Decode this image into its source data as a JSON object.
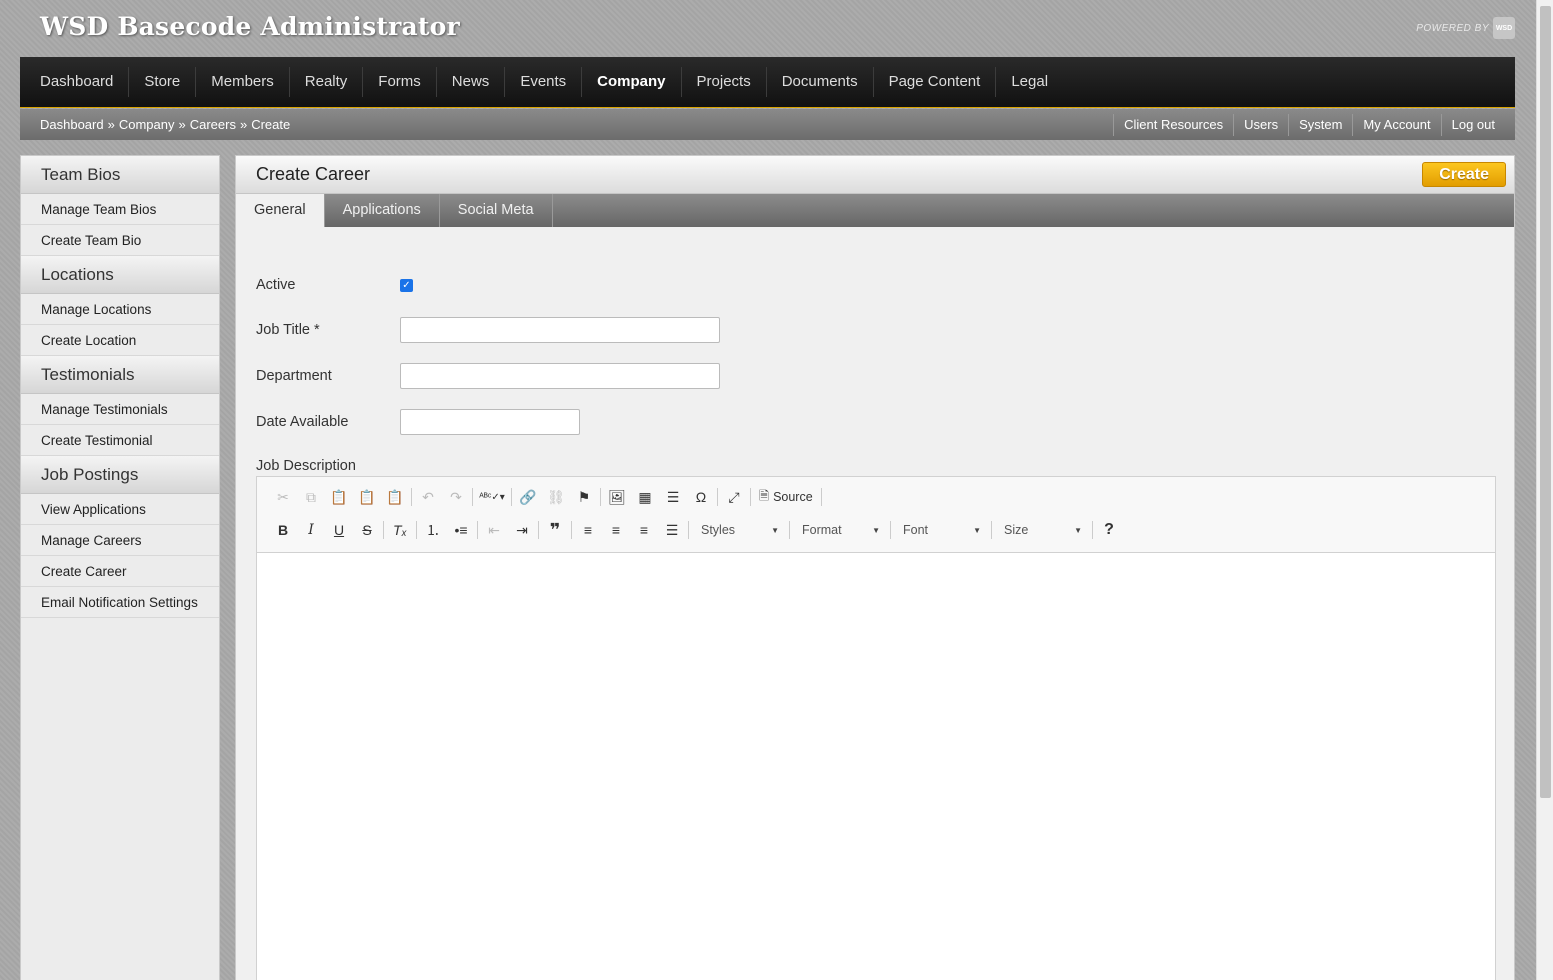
{
  "header": {
    "app_title": "WSD Basecode Administrator",
    "powered_by": "POWERED BY",
    "powered_logo": "WSD"
  },
  "topnav": {
    "items": [
      "Dashboard",
      "Store",
      "Members",
      "Realty",
      "Forms",
      "News",
      "Events",
      "Company",
      "Projects",
      "Documents",
      "Page Content",
      "Legal"
    ],
    "active": "Company"
  },
  "breadcrumb": {
    "items": [
      "Dashboard",
      "Company",
      "Careers",
      "Create"
    ],
    "separator": "»"
  },
  "utility_links": [
    "Client Resources",
    "Users",
    "System",
    "My Account",
    "Log out"
  ],
  "sidebar": {
    "sections": [
      {
        "title": "Team Bios",
        "items": [
          "Manage Team Bios",
          "Create Team Bio"
        ]
      },
      {
        "title": "Locations",
        "items": [
          "Manage Locations",
          "Create Location"
        ]
      },
      {
        "title": "Testimonials",
        "items": [
          "Manage Testimonials",
          "Create Testimonial"
        ]
      },
      {
        "title": "Job Postings",
        "items": [
          "View Applications",
          "Manage Careers",
          "Create Career",
          "Email Notification Settings"
        ]
      }
    ]
  },
  "main": {
    "title": "Create Career",
    "create_label": "Create",
    "tabs": [
      "General",
      "Applications",
      "Social Meta"
    ],
    "active_tab": "General"
  },
  "form": {
    "active_label": "Active",
    "active_checked": true,
    "job_title_label": "Job Title *",
    "job_title_value": "",
    "department_label": "Department",
    "department_value": "",
    "date_available_label": "Date Available",
    "date_available_value": "",
    "job_description_label": "Job Description"
  },
  "editor": {
    "source_label": "Source",
    "styles_label": "Styles",
    "format_label": "Format",
    "font_label": "Font",
    "size_label": "Size",
    "help_label": "?"
  },
  "colors": {
    "accent": "#f5b000",
    "nav_bg": "#1a1a1a",
    "nav_border": "#d9a400",
    "checkbox": "#1a73e8"
  }
}
